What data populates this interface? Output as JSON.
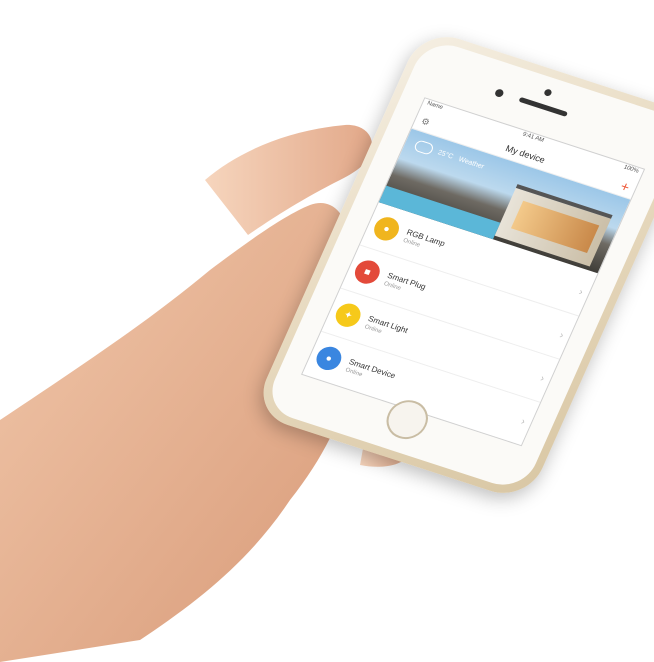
{
  "app": {
    "title": "My device",
    "status_left": "Name",
    "status_time": "9:41 AM",
    "status_right": "100%",
    "weather_temp": "25°C",
    "weather_label": "Weather"
  },
  "devices": [
    {
      "name": "RGB Lamp",
      "status": "Online",
      "color": "#f0b51e"
    },
    {
      "name": "Smart Plug",
      "status": "Online",
      "color": "#e34a3a"
    },
    {
      "name": "Smart Light",
      "status": "Online",
      "color": "#f6c91a"
    },
    {
      "name": "Smart Device",
      "status": "Online",
      "color": "#3a86e0"
    }
  ],
  "icons": {
    "settings": "gear-icon",
    "add": "plus-icon",
    "chevron": "chevron-right-icon"
  }
}
